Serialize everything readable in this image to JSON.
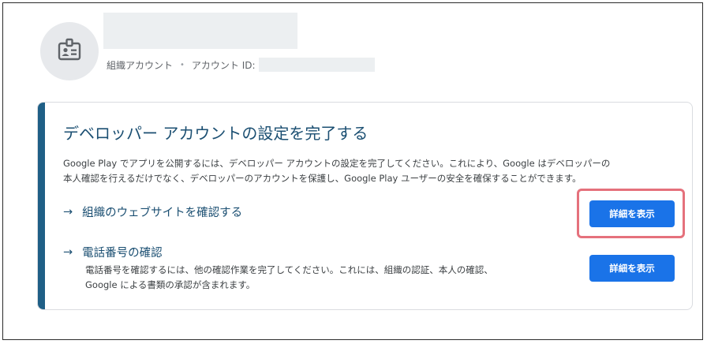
{
  "header": {
    "account_type": "組織アカウント",
    "separator": "•",
    "account_id_label": "アカウント ID:"
  },
  "setup_card": {
    "title": "デベロッパー アカウントの設定を完了する",
    "description_line1": "Google Play でアプリを公開するには、デベロッパー アカウントの設定を完了してください。これにより、Google はデベロッパーの",
    "description_line2": "本人確認を行えるだけでなく、デベロッパーのアカウントを保護し、Google Play ユーザーの安全を確保することができます。",
    "tasks": [
      {
        "arrow": "→",
        "label": "組織のウェブサイトを確認する",
        "button_label": "詳細を表示"
      },
      {
        "arrow": "→",
        "label": "電話番号の確認",
        "description_line1": "電話番号を確認するには、他の確認作業を完了してください。これには、組織の認証、本人の確認、",
        "description_line2": "Google による書類の承認が含まれます。",
        "button_label": "詳細を表示"
      }
    ]
  },
  "colors": {
    "accent_bar": "#1f5f86",
    "title_text": "#1b4f72",
    "button_bg": "#1a73e8",
    "highlight_outline": "#e5717c"
  }
}
